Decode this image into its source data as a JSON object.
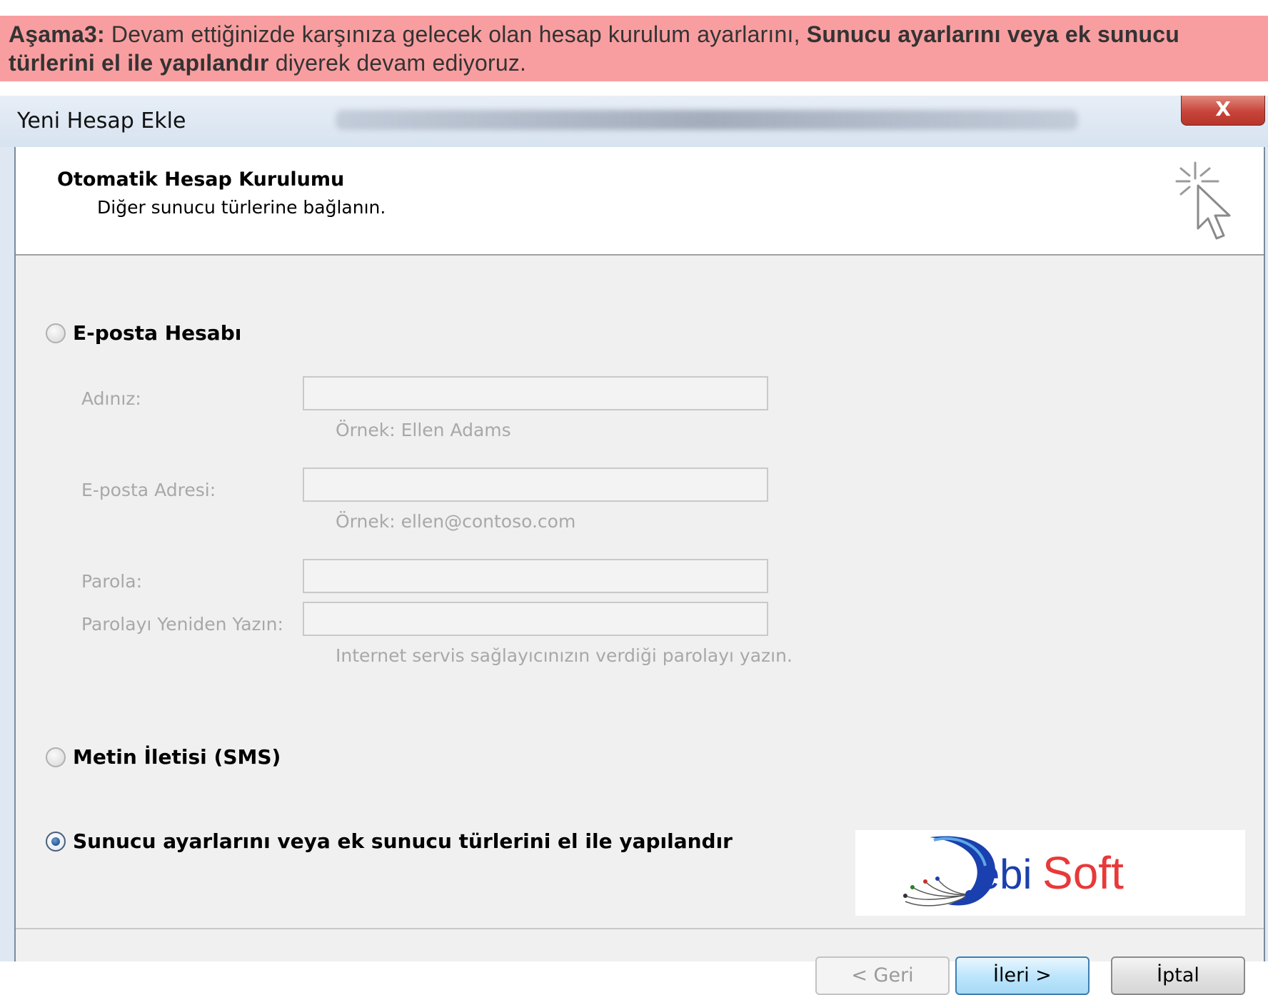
{
  "banner": {
    "step": "Aşama3:",
    "text_before": " Devam ettiğinizde karşınıza gelecek olan hesap kurulum ayarlarını, ",
    "highlight": "Sunucu ayarlarını veya ek sunucu türlerini el ile yapılandır",
    "text_after": " diyerek devam ediyoruz."
  },
  "window": {
    "title": "Yeni Hesap Ekle",
    "close_label": "X"
  },
  "header": {
    "title": "Otomatik Hesap Kurulumu",
    "subtitle": "Diğer sunucu türlerine bağlanın.",
    "icon": "cursor-click-icon"
  },
  "options": {
    "email_account": {
      "label": "E-posta Hesabı",
      "selected": false
    },
    "sms": {
      "label": "Metin İletisi (SMS)",
      "selected": false
    },
    "manual": {
      "label": "Sunucu ayarlarını veya ek sunucu türlerini el ile yapılandır",
      "selected": true
    }
  },
  "fields": {
    "name": {
      "label": "Adınız:",
      "value": "",
      "hint": "Örnek: Ellen Adams"
    },
    "email": {
      "label": "E-posta Adresi:",
      "value": "",
      "hint": "Örnek: ellen@contoso.com"
    },
    "password": {
      "label": "Parola:",
      "value": ""
    },
    "password_confirm": {
      "label": "Parolayı Yeniden Yazın:",
      "value": "",
      "hint": "Internet servis sağlayıcınızın verdiği parolayı yazın."
    }
  },
  "logo": {
    "text_d": "D",
    "text_ebi": "ebi",
    "text_soft": "Soft"
  },
  "buttons": {
    "back": "< Geri",
    "next": "İleri >",
    "cancel": "İptal"
  },
  "colors": {
    "banner_bg": "#f99ea0",
    "close_red": "#c7443a",
    "default_button_blue": "#bee6fd",
    "logo_blue": "#1a3fae",
    "logo_red": "#e8393a"
  }
}
